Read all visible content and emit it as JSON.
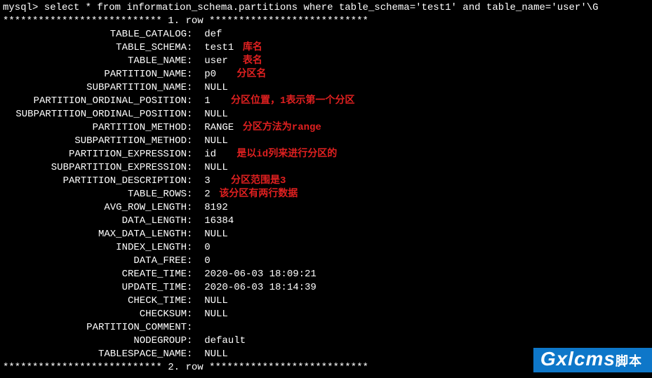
{
  "prompt": "mysql> ",
  "query": "select * from information_schema.partitions where table_schema='test1' and table_name='user'\\G",
  "row_sep1": "*************************** 1. row ***************************",
  "row_sep2": "*************************** 2. row ***************************",
  "fields": [
    {
      "label": "TABLE_CATALOG",
      "value": "def",
      "annot": ""
    },
    {
      "label": "TABLE_SCHEMA",
      "value": "test1",
      "annot": "库名"
    },
    {
      "label": "TABLE_NAME",
      "value": "user ",
      "annot": "表名"
    },
    {
      "label": "PARTITION_NAME",
      "value": "p0  ",
      "annot": "分区名"
    },
    {
      "label": "SUBPARTITION_NAME",
      "value": "NULL",
      "annot": ""
    },
    {
      "label": "PARTITION_ORDINAL_POSITION",
      "value": "1  ",
      "annot": "分区位置，1表示第一个分区"
    },
    {
      "label": "SUBPARTITION_ORDINAL_POSITION",
      "value": "NULL",
      "annot": ""
    },
    {
      "label": "PARTITION_METHOD",
      "value": "RANGE",
      "annot": "分区方法为range"
    },
    {
      "label": "SUBPARTITION_METHOD",
      "value": "NULL",
      "annot": ""
    },
    {
      "label": "PARTITION_EXPRESSION",
      "value": "id  ",
      "annot": "是以id列来进行分区的"
    },
    {
      "label": "SUBPARTITION_EXPRESSION",
      "value": "NULL",
      "annot": ""
    },
    {
      "label": "PARTITION_DESCRIPTION",
      "value": "3  ",
      "annot": "分区范围是3"
    },
    {
      "label": "TABLE_ROWS",
      "value": "2",
      "annot": "该分区有两行数据"
    },
    {
      "label": "AVG_ROW_LENGTH",
      "value": "8192",
      "annot": ""
    },
    {
      "label": "DATA_LENGTH",
      "value": "16384",
      "annot": ""
    },
    {
      "label": "MAX_DATA_LENGTH",
      "value": "NULL",
      "annot": ""
    },
    {
      "label": "INDEX_LENGTH",
      "value": "0",
      "annot": ""
    },
    {
      "label": "DATA_FREE",
      "value": "0",
      "annot": ""
    },
    {
      "label": "CREATE_TIME",
      "value": "2020-06-03 18:09:21",
      "annot": ""
    },
    {
      "label": "UPDATE_TIME",
      "value": "2020-06-03 18:14:39",
      "annot": ""
    },
    {
      "label": "CHECK_TIME",
      "value": "NULL",
      "annot": ""
    },
    {
      "label": "CHECKSUM",
      "value": "NULL",
      "annot": ""
    },
    {
      "label": "PARTITION_COMMENT",
      "value": "",
      "annot": ""
    },
    {
      "label": "NODEGROUP",
      "value": "default",
      "annot": ""
    },
    {
      "label": "TABLESPACE_NAME",
      "value": "NULL",
      "annot": ""
    }
  ],
  "watermark": {
    "main": "Gxlcms",
    "sub": "脚本"
  }
}
